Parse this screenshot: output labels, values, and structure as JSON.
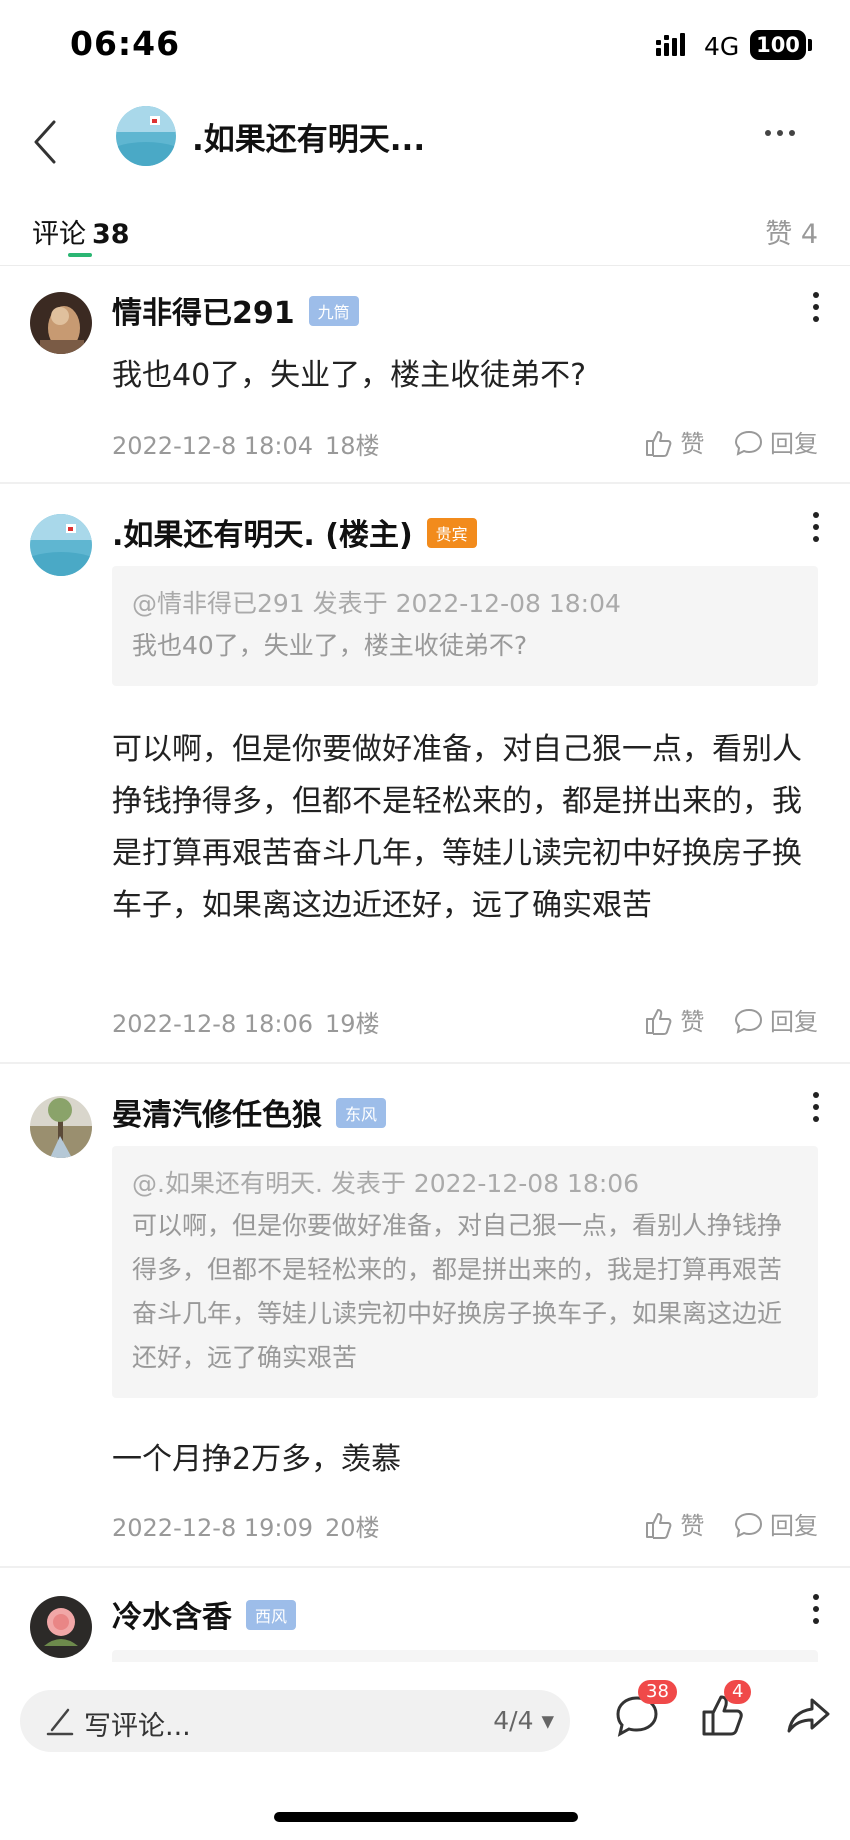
{
  "status_bar": {
    "time": "06:46",
    "network": "4G",
    "battery": "100"
  },
  "header": {
    "title": ".如果还有明天..."
  },
  "tabs": {
    "comments_label": "评论",
    "comments_count": "38",
    "likes_label": "赞 4"
  },
  "comments": [
    {
      "username": "情非得已291",
      "badge": "九筒",
      "text": "我也40了，失业了，楼主收徒弟不?",
      "time": "2022-12-8 18:04",
      "floor": "18楼",
      "like_label": "赞",
      "reply_label": "回复"
    },
    {
      "username": ".如果还有明天. (楼主)",
      "badge": "贵宾",
      "quote_head": "@情非得已291 发表于 2022-12-08 18:04",
      "quote_text": "我也40了，失业了，楼主收徒弟不?",
      "text": "可以啊，但是你要做好准备，对自己狠一点，看别人挣钱挣得多，但都不是轻松来的，都是拼出来的，我是打算再艰苦奋斗几年，等娃儿读完初中好换房子换车子，如果离这边近还好，远了确实艰苦",
      "time": "2022-12-8 18:06",
      "floor": "19楼",
      "like_label": "赞",
      "reply_label": "回复"
    },
    {
      "username": "晏清汽修任色狼",
      "badge": "东风",
      "quote_head": "@.如果还有明天. 发表于 2022-12-08 18:06",
      "quote_text": "可以啊，但是你要做好准备，对自己狠一点，看别人挣钱挣得多，但都不是轻松来的，都是拼出来的，我是打算再艰苦奋斗几年，等娃儿读完初中好换房子换车子，如果离这边近还好，远了确实艰苦",
      "text": "一个月挣2万多，羡慕",
      "time": "2022-12-8 19:09",
      "floor": "20楼",
      "like_label": "赞",
      "reply_label": "回复"
    },
    {
      "username": "冷水含香",
      "badge": "西风"
    }
  ],
  "bottom_bar": {
    "input_placeholder": "写评论...",
    "page_indicator": "4/4",
    "comment_count": "38",
    "like_count": "4"
  },
  "colors": {
    "accent_green": "#2bb673",
    "badge_blue": "#9dbde9",
    "badge_orange": "#f28b1c",
    "count_red": "#f04949"
  },
  "icons": [
    "back-icon",
    "more-icon",
    "kebab-icon",
    "thumbs-up-icon",
    "reply-bubble-icon",
    "pen-icon",
    "comment-icon",
    "like-icon",
    "share-icon",
    "signal-icon",
    "battery-icon"
  ]
}
